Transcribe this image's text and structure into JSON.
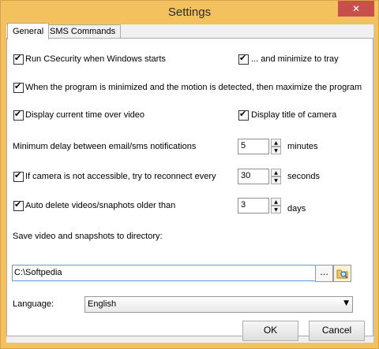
{
  "window": {
    "title": "Settings",
    "close_glyph": "✕"
  },
  "tabs": [
    {
      "label": "General",
      "active": true
    },
    {
      "label": "SMS Commands",
      "active": false
    }
  ],
  "general": {
    "run_on_start": {
      "label": "Run CSecurity when Windows starts",
      "checked": true
    },
    "minimize_to_tray": {
      "label": "... and minimize to tray",
      "checked": true
    },
    "maximize_on_motion": {
      "label": "When the program is minimized and the motion is detected, then maximize the program",
      "checked": true
    },
    "display_time": {
      "label": "Display current time over video",
      "checked": true
    },
    "display_title": {
      "label": "Display title of camera",
      "checked": true
    },
    "min_delay": {
      "label": "Minimum delay between email/sms notifications",
      "value": "5",
      "unit": "minutes"
    },
    "reconnect": {
      "label": "If camera is not accessible, try to reconnect every",
      "checked": true,
      "value": "30",
      "unit": "seconds"
    },
    "auto_delete": {
      "label": "Auto delete videos/snaphots  older than",
      "checked": true,
      "value": "3",
      "unit": "days"
    },
    "save_dir": {
      "label": "Save video and snapshots to directory:",
      "value": "C:\\Softpedia",
      "browse_label": "..."
    },
    "language": {
      "label": "Language:",
      "value": "English"
    }
  },
  "footer": {
    "ok_label": "OK",
    "cancel_label": "Cancel"
  },
  "icons": {
    "check": "✔",
    "spin_up": "▲",
    "spin_down": "▼",
    "dropdown": "▼",
    "folder": "folder-search-icon"
  }
}
